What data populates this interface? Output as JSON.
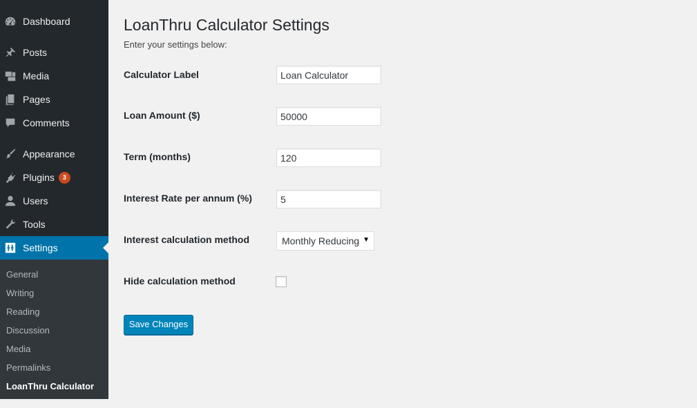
{
  "sidebar": {
    "items": [
      {
        "label": "Dashboard",
        "icon": "dashboard-icon"
      },
      {
        "label": "Posts",
        "icon": "pin-icon"
      },
      {
        "label": "Media",
        "icon": "media-icon"
      },
      {
        "label": "Pages",
        "icon": "pages-icon"
      },
      {
        "label": "Comments",
        "icon": "comment-icon"
      },
      {
        "label": "Appearance",
        "icon": "paintbrush-icon"
      },
      {
        "label": "Plugins",
        "icon": "plugin-icon",
        "badge": "3"
      },
      {
        "label": "Users",
        "icon": "user-icon"
      },
      {
        "label": "Tools",
        "icon": "wrench-icon"
      },
      {
        "label": "Settings",
        "icon": "settings-icon",
        "active": true
      }
    ],
    "submenu": [
      "General",
      "Writing",
      "Reading",
      "Discussion",
      "Media",
      "Permalinks",
      "LoanThru Calculator"
    ],
    "accent": "#0073aa",
    "badge_color": "#ca4a1f"
  },
  "main": {
    "title": "LoanThru Calculator Settings",
    "subtitle": "Enter your settings below:",
    "fields": {
      "calculator_label": {
        "label": "Calculator Label",
        "value": "Loan Calculator"
      },
      "loan_amount": {
        "label": "Loan Amount ($)",
        "value": "50000"
      },
      "term": {
        "label": "Term (months)",
        "value": "120"
      },
      "interest_rate": {
        "label": "Interest Rate per annum (%)",
        "value": "5"
      },
      "method": {
        "label": "Interest calculation method",
        "value": "Monthly Reducing"
      },
      "hide_method": {
        "label": "Hide calculation method",
        "checked": false
      }
    },
    "save_label": "Save Changes",
    "button_color": "#0085ba"
  }
}
